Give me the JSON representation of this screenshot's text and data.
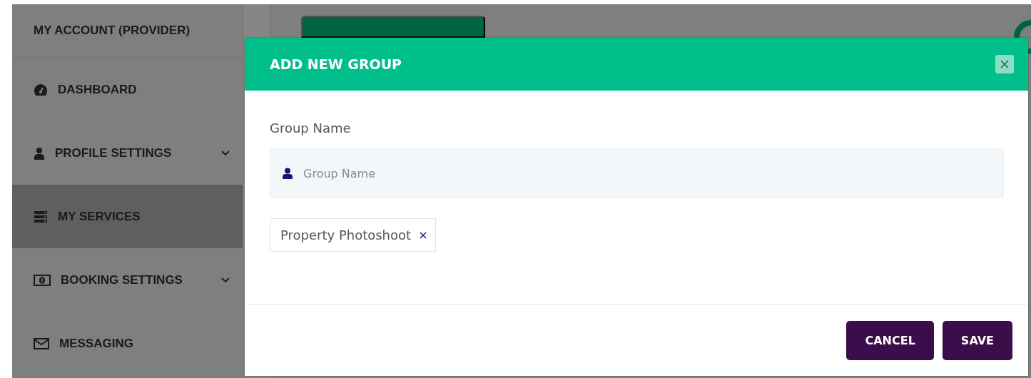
{
  "sidebar": {
    "title": "MY ACCOUNT (PROVIDER)",
    "items": [
      {
        "label": "DASHBOARD",
        "expandable": false,
        "selected": false
      },
      {
        "label": "PROFILE SETTINGS",
        "expandable": true,
        "selected": false
      },
      {
        "label": "MY SERVICES",
        "expandable": false,
        "selected": true
      },
      {
        "label": "BOOKING SETTINGS",
        "expandable": true,
        "selected": false
      },
      {
        "label": "MESSAGING",
        "expandable": false,
        "selected": false
      }
    ]
  },
  "modal": {
    "title": "ADD NEW GROUP",
    "field_label": "Group Name",
    "field": {
      "placeholder": "Group Name"
    },
    "tags": [
      {
        "label": "Property Photoshoot"
      }
    ],
    "buttons": [
      "CANCEL",
      "SAVE"
    ]
  }
}
